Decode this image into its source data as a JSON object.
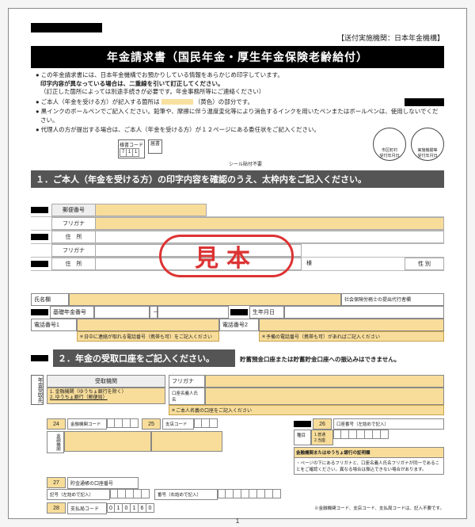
{
  "header": {
    "org": "【送付実施機関：日本年金機構】"
  },
  "title": "年金請求書（国民年金・厚生年金保険老齢給付）",
  "bullets": [
    "この年金請求書には、日本年金機構でお預かりしている情報をあらかじめ印字しています。",
    "印字内容が異なっている場合は、二重線を引いて訂正してください。",
    "（訂正した箇所によっては別途手続きが必要です。年金事務所等にご連絡ください）",
    "ご本人（年金を受ける方）が記入する箇所は　　　　（黄色）の部分です。",
    "黒インクのボールペンでご記入ください。鉛筆や、摩擦に伴う温度変化等により消色するインクを用いたペンまたはボールペンは、使用しないでください。",
    "代理人の方が提出する場合は、ご本人（年金を受ける方）が１２ページにある委任状をご記入ください。"
  ],
  "codebox": {
    "label": "様書コード",
    "digits": [
      "7",
      "1",
      "1"
    ]
  },
  "sealNote": "シール貼付不要",
  "stamp_label": "届書",
  "seals": {
    "a_top": "市区町村",
    "a_bot": "受付年月日",
    "b_top": "実施機関等",
    "b_bot": "受付年月日"
  },
  "section1": "１．ご本人（年金を受ける方）の印字内容を確認のうえ、太枠内をご記入ください。",
  "sample": "見本",
  "form1": {
    "postal": "郵便番号",
    "furigana": "フリガナ",
    "address": "住　所",
    "furigana2": "フリガナ",
    "address2": "住　所",
    "sama": "様",
    "sei": "性 別"
  },
  "tbl2": {
    "shimei": "氏名欄",
    "daisho": "社会保険労務士の提出代行者欄",
    "kiso": "基礎年金番号",
    "dash": "－",
    "sei_ymd": "生年月日",
    "tel1": "電話番号1",
    "tel2": "電話番号2",
    "hint1": "＊日中に連絡が取れる電話番号（携帯も可）をご記入ください",
    "hint2": "＊予備の電話番号（携帯も可）があればご記入ください"
  },
  "section2": "２．年金の受取口座をご記入ください。",
  "section2_note": "貯蓄預金口座または貯蓄貯金口座への振込みはできません。",
  "sidelabel": "年金受取先",
  "bank": {
    "recv_inst": "受取機関",
    "opt1": "1. 金融機関（ゆうちょ銀行を除く）",
    "opt2": "2. ゆうちょ銀行（郵便局）",
    "furigana": "フリガナ",
    "kouza_meigi": "口座名義人氏　名",
    "kouza_hint": "＊ご本人名義の口座をご記入ください",
    "kinyu_lab": "金融機関",
    "shiten_lab": "支店コード",
    "ytcode_lab": "金融機関コード",
    "copy_hint": "口座番号（左詰めで記入）",
    "shumoku": "種目",
    "shumoku_opts": "1.普通\n2.当座",
    "note_right_title": "金融機関またはゆうちょ銀行の証明欄",
    "note_right_body": "・ページの下にあるフリガナと、口座名義人氏名フリガナが同一であることをご確認ください。異なる場合は振込できない場合があります。",
    "yucho_lab": "貯金通帳の口座番号",
    "kigou": "記号（左詰めで記入）",
    "bangou": "番号（右詰めで記入）",
    "shiharai": "支払局コード",
    "shiharai_digits": [
      "0",
      "1",
      "0",
      "1",
      "6",
      "0"
    ],
    "foot_note": "※金融機関コード、支店コード、支払局コードは、記入不要です。"
  },
  "pagenum": "1"
}
